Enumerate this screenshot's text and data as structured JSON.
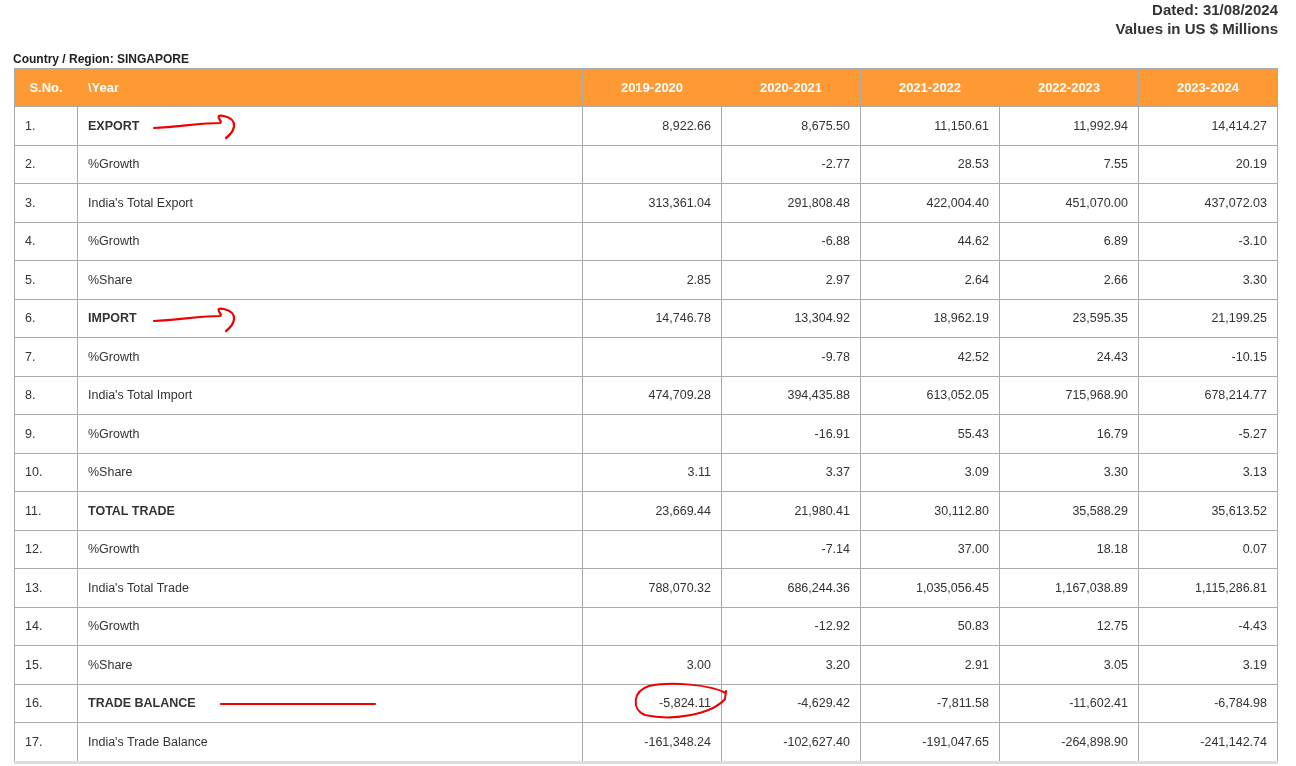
{
  "header": {
    "dated": "Dated: 31/08/2024",
    "units": "Values in US $ Millions"
  },
  "region_label": "Country / Region:  SINGAPORE",
  "table": {
    "columns": [
      "S.No.",
      "\\Year",
      "2019-2020",
      "2020-2021",
      "2021-2022",
      "2022-2023",
      "2023-2024"
    ],
    "rows": [
      {
        "bold": true,
        "arrowed": true,
        "underlined": false,
        "circled": false,
        "cells": [
          {
            "value": "1."
          },
          {
            "value": "EXPORT"
          },
          {
            "value": "8,922.66"
          },
          {
            "value": "8,675.50"
          },
          {
            "value": "11,150.61"
          },
          {
            "value": "11,992.94"
          },
          {
            "value": "14,414.27"
          }
        ]
      },
      {
        "bold": false,
        "arrowed": false,
        "underlined": false,
        "circled": false,
        "cells": [
          {
            "value": "2."
          },
          {
            "value": "%Growth"
          },
          {},
          {
            "value": "-2.77"
          },
          {
            "value": "28.53"
          },
          {
            "value": "7.55"
          },
          {
            "value": "20.19"
          }
        ]
      },
      {
        "bold": false,
        "arrowed": false,
        "underlined": false,
        "circled": false,
        "cells": [
          {
            "value": "3."
          },
          {
            "value": "India's Total Export"
          },
          {
            "value": "313,361.04"
          },
          {
            "value": "291,808.48"
          },
          {
            "value": "422,004.40"
          },
          {
            "value": "451,070.00"
          },
          {
            "value": "437,072.03"
          }
        ]
      },
      {
        "bold": false,
        "arrowed": false,
        "underlined": false,
        "circled": false,
        "cells": [
          {
            "value": "4."
          },
          {
            "value": "%Growth"
          },
          {},
          {
            "value": "-6.88"
          },
          {
            "value": "44.62"
          },
          {
            "value": "6.89"
          },
          {
            "value": "-3.10"
          }
        ]
      },
      {
        "bold": false,
        "arrowed": false,
        "underlined": false,
        "circled": false,
        "cells": [
          {
            "value": "5."
          },
          {
            "value": "%Share"
          },
          {
            "value": "2.85"
          },
          {
            "value": "2.97"
          },
          {
            "value": "2.64"
          },
          {
            "value": "2.66"
          },
          {
            "value": "3.30"
          }
        ]
      },
      {
        "bold": true,
        "arrowed": true,
        "underlined": false,
        "circled": false,
        "cells": [
          {
            "value": "6."
          },
          {
            "value": "IMPORT"
          },
          {
            "value": "14,746.78"
          },
          {
            "value": "13,304.92"
          },
          {
            "value": "18,962.19"
          },
          {
            "value": "23,595.35"
          },
          {
            "value": "21,199.25"
          }
        ]
      },
      {
        "bold": false,
        "arrowed": false,
        "underlined": false,
        "circled": false,
        "cells": [
          {
            "value": "7."
          },
          {
            "value": "%Growth"
          },
          {},
          {
            "value": "-9.78"
          },
          {
            "value": "42.52"
          },
          {
            "value": "24.43"
          },
          {
            "value": "-10.15"
          }
        ]
      },
      {
        "bold": false,
        "arrowed": false,
        "underlined": false,
        "circled": false,
        "cells": [
          {
            "value": "8."
          },
          {
            "value": "India's Total Import"
          },
          {
            "value": "474,709.28"
          },
          {
            "value": "394,435.88"
          },
          {
            "value": "613,052.05"
          },
          {
            "value": "715,968.90"
          },
          {
            "value": "678,214.77"
          }
        ]
      },
      {
        "bold": false,
        "arrowed": false,
        "underlined": false,
        "circled": false,
        "cells": [
          {
            "value": "9."
          },
          {
            "value": "%Growth"
          },
          {},
          {
            "value": "-16.91"
          },
          {
            "value": "55.43"
          },
          {
            "value": "16.79"
          },
          {
            "value": "-5.27"
          }
        ]
      },
      {
        "bold": false,
        "arrowed": false,
        "underlined": false,
        "circled": false,
        "cells": [
          {
            "value": "10."
          },
          {
            "value": "%Share"
          },
          {
            "value": "3.11"
          },
          {
            "value": "3.37"
          },
          {
            "value": "3.09"
          },
          {
            "value": "3.30"
          },
          {
            "value": "3.13"
          }
        ]
      },
      {
        "bold": true,
        "arrowed": false,
        "underlined": false,
        "circled": false,
        "cells": [
          {
            "value": "11."
          },
          {
            "value": "TOTAL TRADE"
          },
          {
            "value": "23,669.44"
          },
          {
            "value": "21,980.41"
          },
          {
            "value": "30,112.80"
          },
          {
            "value": "35,588.29"
          },
          {
            "value": "35,613.52"
          }
        ]
      },
      {
        "bold": false,
        "arrowed": false,
        "underlined": false,
        "circled": false,
        "cells": [
          {
            "value": "12."
          },
          {
            "value": "%Growth"
          },
          {},
          {
            "value": "-7.14"
          },
          {
            "value": "37.00"
          },
          {
            "value": "18.18"
          },
          {
            "value": "0.07"
          }
        ]
      },
      {
        "bold": false,
        "arrowed": false,
        "underlined": false,
        "circled": false,
        "cells": [
          {
            "value": "13."
          },
          {
            "value": "India's Total Trade"
          },
          {
            "value": "788,070.32"
          },
          {
            "value": "686,244.36"
          },
          {
            "value": "1,035,056.45"
          },
          {
            "value": "1,167,038.89"
          },
          {
            "value": "1,115,286.81"
          }
        ]
      },
      {
        "bold": false,
        "arrowed": false,
        "underlined": false,
        "circled": false,
        "cells": [
          {
            "value": "14."
          },
          {
            "value": "%Growth"
          },
          {},
          {
            "value": "-12.92"
          },
          {
            "value": "50.83"
          },
          {
            "value": "12.75"
          },
          {
            "value": "-4.43"
          }
        ]
      },
      {
        "bold": false,
        "arrowed": false,
        "underlined": false,
        "circled": false,
        "cells": [
          {
            "value": "15."
          },
          {
            "value": "%Share"
          },
          {
            "value": "3.00"
          },
          {
            "value": "3.20"
          },
          {
            "value": "2.91"
          },
          {
            "value": "3.05"
          },
          {
            "value": "3.19"
          }
        ]
      },
      {
        "bold": true,
        "arrowed": false,
        "underlined": true,
        "circled": true,
        "cells": [
          {
            "value": "16."
          },
          {
            "value": "TRADE BALANCE"
          },
          {
            "value": "-5,824.11"
          },
          {
            "value": "-4,629.42"
          },
          {
            "value": "-7,811.58"
          },
          {
            "value": "-11,602.41"
          },
          {
            "value": "-6,784.98"
          }
        ]
      },
      {
        "bold": false,
        "arrowed": false,
        "underlined": false,
        "circled": false,
        "cells": [
          {
            "value": "17."
          },
          {
            "value": "India's Trade Balance"
          },
          {
            "value": "-161,348.24"
          },
          {
            "value": "-102,627.40"
          },
          {
            "value": "-191,047.65"
          },
          {
            "value": "-264,898.90"
          },
          {
            "value": "-241,142.74"
          }
        ]
      }
    ]
  }
}
